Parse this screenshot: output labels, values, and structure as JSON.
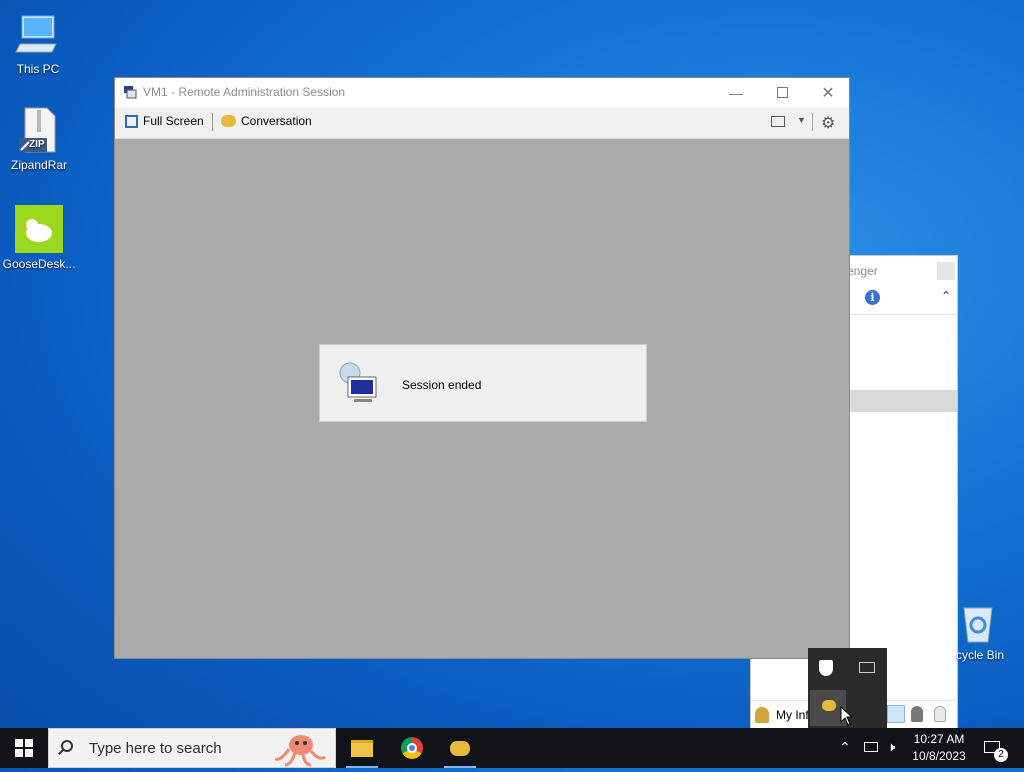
{
  "desktop": {
    "icons": [
      {
        "label": "This PC"
      },
      {
        "label": "ZipandRar"
      },
      {
        "label": "GooseDesk..."
      },
      {
        "label": "cycle Bin"
      }
    ],
    "zip_badge": "ZIP"
  },
  "remote_window": {
    "title": "VM1 - Remote Administration Session",
    "toolbar": {
      "full_screen": "Full Screen",
      "conversation": "Conversation"
    },
    "dialog": {
      "message": "Session ended"
    }
  },
  "messenger_window": {
    "title_partial": "enger",
    "bottom": {
      "my_info": "My Info"
    }
  },
  "taskbar": {
    "search_placeholder": "Type here to search",
    "clock_time": "10:27 AM",
    "clock_date": "10/8/2023",
    "notification_count": "2"
  },
  "colors": {
    "desktop_blue": "#1576d6",
    "remote_bg": "#aaaaaa",
    "taskbar": "#101419"
  }
}
